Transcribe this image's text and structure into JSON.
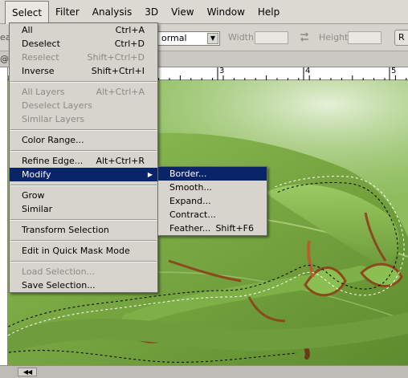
{
  "menubar": {
    "items": [
      {
        "label": "Select"
      },
      {
        "label": "Filter"
      },
      {
        "label": "Analysis"
      },
      {
        "label": "3D"
      },
      {
        "label": "View"
      },
      {
        "label": "Window"
      },
      {
        "label": "Help"
      }
    ]
  },
  "options_bar": {
    "left_fragment": "ea",
    "style_value": "ormal",
    "width_label": "Width:",
    "height_label": "Height:",
    "right_button_fragment": "R"
  },
  "doc_tab": {
    "left_fragment": "@"
  },
  "ruler": {
    "labels": [
      "3",
      "4",
      "5"
    ]
  },
  "select_menu": {
    "items": [
      {
        "label": "All",
        "shortcut": "Ctrl+A"
      },
      {
        "label": "Deselect",
        "shortcut": "Ctrl+D"
      },
      {
        "label": "Reselect",
        "shortcut": "Shift+Ctrl+D",
        "disabled": true
      },
      {
        "label": "Inverse",
        "shortcut": "Shift+Ctrl+I"
      },
      {
        "label": "All Layers",
        "shortcut": "Alt+Ctrl+A",
        "disabled": true
      },
      {
        "label": "Deselect Layers",
        "shortcut": "",
        "disabled": true
      },
      {
        "label": "Similar Layers",
        "shortcut": "",
        "disabled": true
      },
      {
        "label": "Color Range...",
        "shortcut": ""
      },
      {
        "label": "Refine Edge...",
        "shortcut": "Alt+Ctrl+R"
      },
      {
        "label": "Modify",
        "shortcut": "",
        "highlighted": true
      },
      {
        "label": "Grow",
        "shortcut": ""
      },
      {
        "label": "Similar",
        "shortcut": ""
      },
      {
        "label": "Transform Selection",
        "shortcut": ""
      },
      {
        "label": "Edit in Quick Mask Mode",
        "shortcut": ""
      },
      {
        "label": "Load Selection...",
        "shortcut": "",
        "disabled": true
      },
      {
        "label": "Save Selection...",
        "shortcut": ""
      }
    ]
  },
  "modify_submenu": {
    "items": [
      {
        "label": "Border...",
        "shortcut": "",
        "highlighted": true
      },
      {
        "label": "Smooth...",
        "shortcut": ""
      },
      {
        "label": "Expand...",
        "shortcut": ""
      },
      {
        "label": "Contract...",
        "shortcut": ""
      },
      {
        "label": "Feather...",
        "shortcut": "Shift+F6"
      }
    ]
  },
  "colors": {
    "menu_bg": "#d6d4cd",
    "highlight": "#0a246a",
    "disabled_text": "#8b8a84",
    "leaf_green": "#6e9a3a",
    "insect_brown": "#8a4a1c"
  }
}
